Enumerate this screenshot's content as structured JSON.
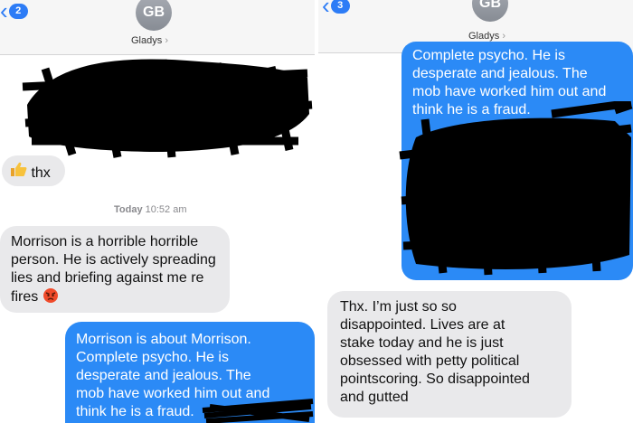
{
  "left": {
    "back_badge": "2",
    "avatar_initials": "GB",
    "contact_name": "Gladys",
    "contact_chevron": "›",
    "reaction_message": "thx",
    "reaction_emoji_icon": "thumbs-up-emoji",
    "timestamp_day": "Today",
    "timestamp_time": "10:52 am",
    "received_message": "Morrison is a horrible horrible person.  He is actively spreading lies and briefing against me re fires",
    "received_emoji_icon": "angry-face-emoji",
    "sent_message_lines": [
      "Morrison is about Morrison.",
      "Complete psycho. He is",
      "desperate and jealous. The",
      "mob have worked him out and",
      "think he is a fraud."
    ]
  },
  "right": {
    "back_badge": "3",
    "avatar_initials": "GB",
    "contact_name": "Gladys",
    "contact_chevron": "›",
    "sent_message_lines": [
      "Complete psycho. He is",
      "desperate and jealous. The",
      "mob have worked him out and",
      "think he is a fraud."
    ],
    "received_message_lines": [
      "Thx.  I’m just so so",
      "disappointed.  Lives are at",
      "stake today and he is just",
      "obsessed with petty political",
      "pointscoring. So disappointed",
      "and gutted"
    ]
  },
  "colors": {
    "accent": "#2d7cf6",
    "sent_bubble": "#2b8af6",
    "received_bubble": "#e9e9eb",
    "redaction": "#000000"
  }
}
